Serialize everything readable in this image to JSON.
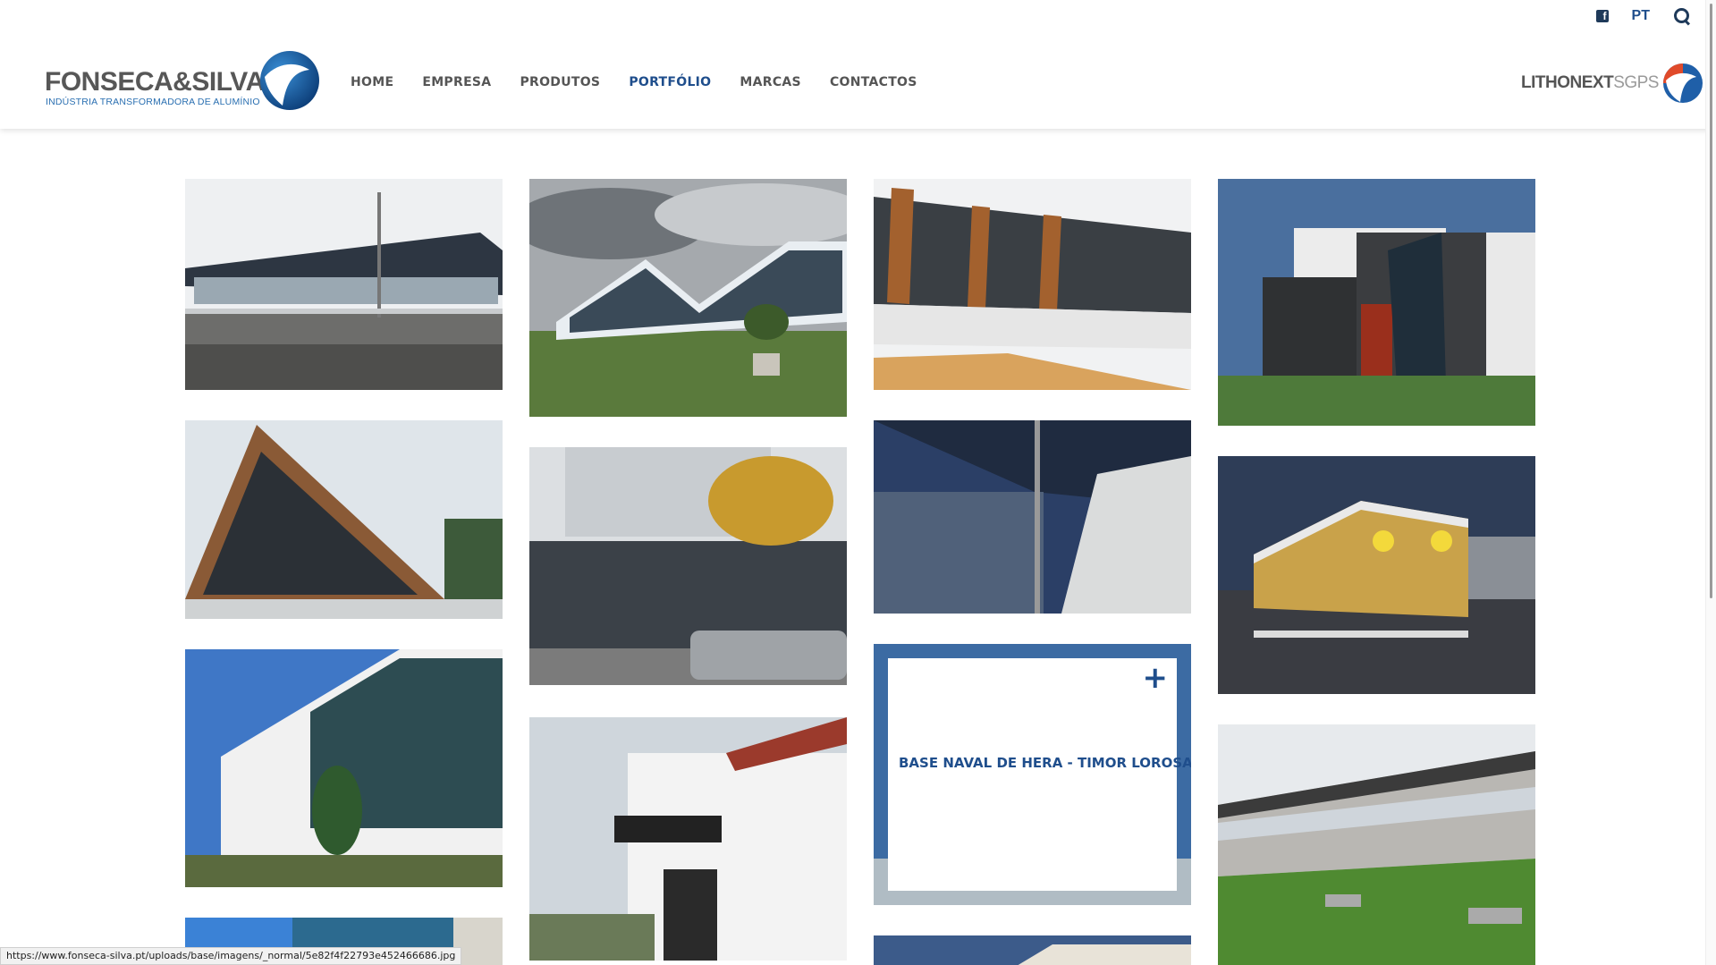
{
  "header": {
    "logo": {
      "name": "FONSECA&SILVA",
      "tagline": "INDÚSTRIA TRANSFORMADORA DE ALUMÍNIO"
    },
    "topbar": {
      "facebook_glyph": "f",
      "language": "PT"
    },
    "nav": [
      {
        "label": "HOME",
        "active": false
      },
      {
        "label": "EMPRESA",
        "active": false
      },
      {
        "label": "PRODUTOS",
        "active": false
      },
      {
        "label": "PORTFÓLIO",
        "active": true
      },
      {
        "label": "MARCAS",
        "active": false
      },
      {
        "label": "CONTACTOS",
        "active": false
      }
    ],
    "group_logo": {
      "bold": "LITHONEXT",
      "light": "SGPS"
    }
  },
  "portfolio": {
    "hovered_item": {
      "title": "BASE NAVAL DE HERA - TIMOR LOROSAE",
      "plus": "+"
    }
  },
  "status_bar": {
    "url": "https://www.fonseca-silva.pt/uploads/base/imagens/_normal/5e82f4f22793e452466686.jpg"
  },
  "colors": {
    "brand_blue": "#1f4e8c",
    "nav_gray": "#555555",
    "accent_red": "#d9442b"
  }
}
